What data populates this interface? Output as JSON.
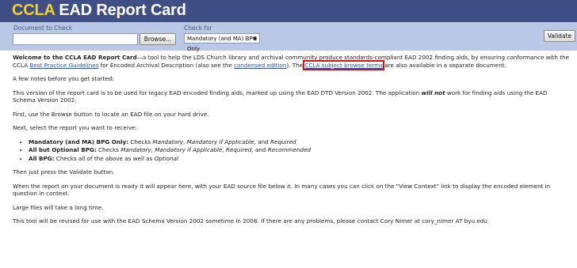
{
  "header": {
    "title_accent": "CCLA",
    "title_rest": " EAD Report Card"
  },
  "form": {
    "document_label": "Document to Check",
    "browse_label": "Browse...",
    "check_label": "Check for",
    "check_selected": "Mandatory (and MA) BPG Only",
    "validate_label": "Validate"
  },
  "content": {
    "intro_bold": "Welcome to the CCLA EAD Report Card",
    "intro_1": "—a tool to help the LDS Church library and archival community produce standards-compliant EAD 2002 finding aids, by ensuring conformance with the CCLA ",
    "link_bpg": "Best Practice Guidelines",
    "intro_2": " for Encoded Archival Description (also see the ",
    "link_condensed": "condensed edition",
    "intro_3": "). The ",
    "link_subject": "CCLA subject browse terms",
    "intro_4": " are also available in a separate document.",
    "notes_intro": "A few notes before you get started:",
    "version_1": "This version of the report card is to be used for legacy EAD-encoded finding aids, marked up using the EAD DTD Version 2002. The application ",
    "version_bold": "will not",
    "version_2": " work for finding aids using the EAD Schema Version 2002.",
    "first_step": "First, use the Browse button to locate an EAD file on your hard drive.",
    "next_step": "Next, select the report you want to receive:",
    "options": [
      {
        "bold": "Mandatory (and MA) BPG Only:",
        "pre": " Checks ",
        "it1": "Mandatory",
        "mid1": ", ",
        "it2": "Mandatory if Applicable",
        "mid2": ", and ",
        "it3": "Required",
        "post": ""
      },
      {
        "bold": "All but Optional BPG:",
        "pre": " Checks ",
        "it1": "Mandatory",
        "mid1": ", ",
        "it2": "Mandatory if Applicable, Required,",
        "mid2": " and ",
        "it3": "Recommended",
        "post": ""
      },
      {
        "bold": "All BPG:",
        "pre": " Checks all of the above as well as ",
        "it1": "",
        "mid1": "",
        "it2": "",
        "mid2": "",
        "it3": "Optional",
        "post": ""
      }
    ],
    "validate_step": "Then just press the Validate button.",
    "report_info": "When the report on your document is ready it will appear here, with your EAD source file below it. In many cases you can click on the \"View Context\" link to display the encoded element in question in context.",
    "large_files": "Large files will take a long time.",
    "revision": "This tool will be revised for use with the EAD Schema Version 2002 sometime in 2008. If there are any problems, please contact Cory Nimer at cory_nimer AT byu.edu."
  },
  "colors": {
    "header_bg": "#3f4f86",
    "form_bg": "#b9c8e6",
    "title_accent": "#f2cf3a",
    "highlight_box": "#e01010"
  }
}
